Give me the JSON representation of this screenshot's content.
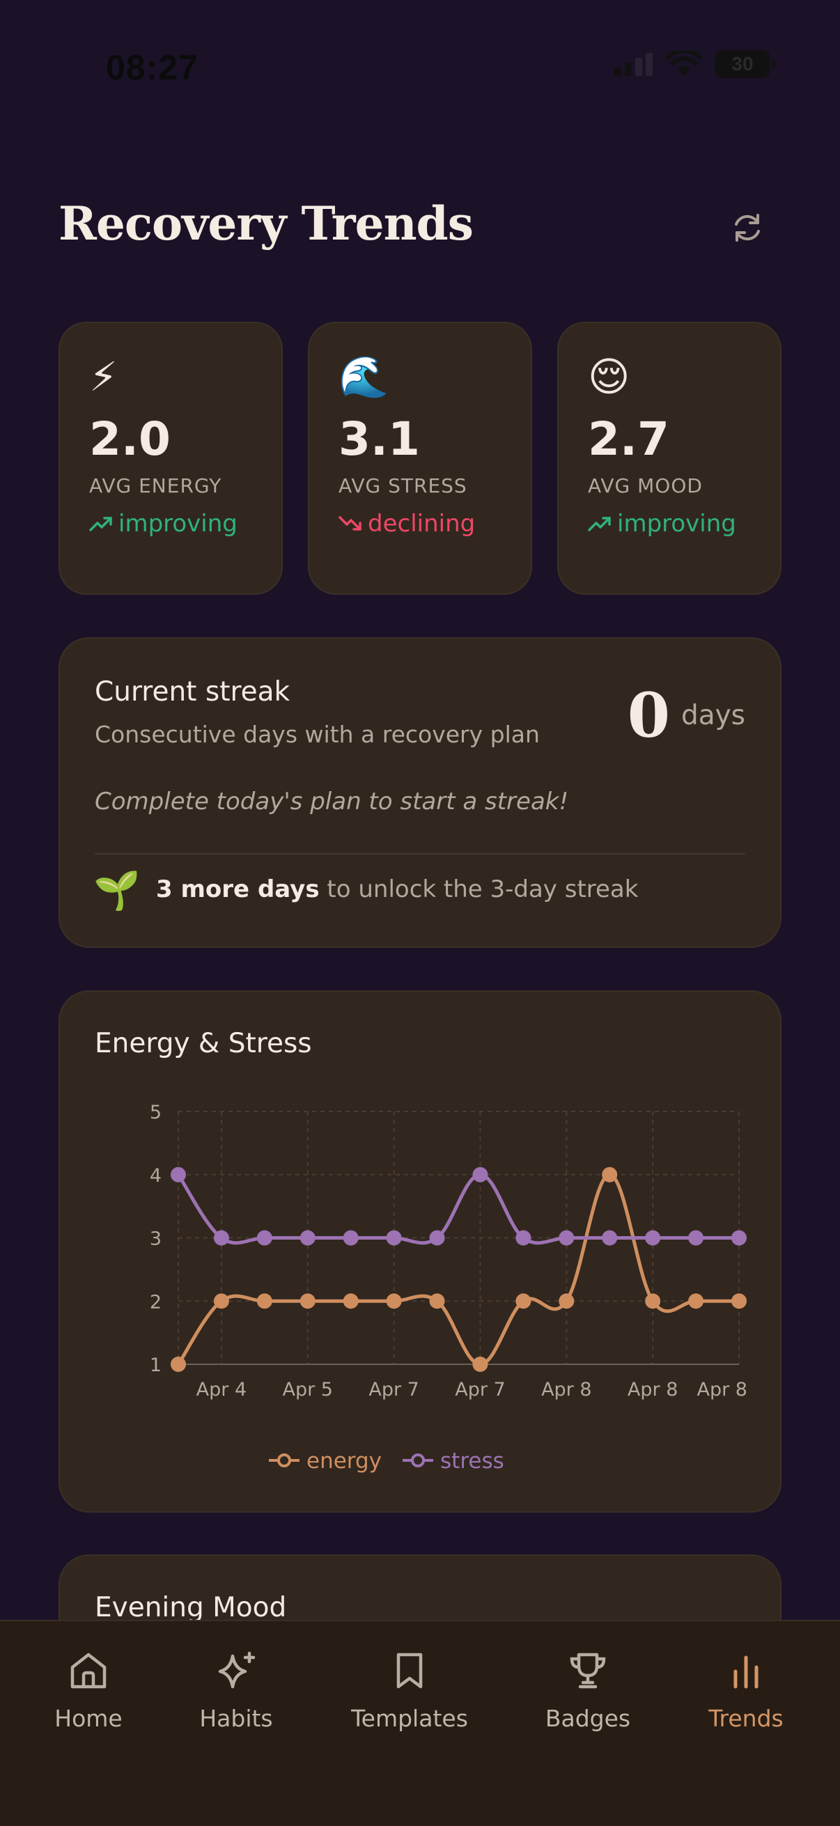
{
  "status_bar": {
    "time": "08:27",
    "battery": "30"
  },
  "header": {
    "title": "Recovery Trends"
  },
  "stats": [
    {
      "emoji": "⚡",
      "value": "2.0",
      "label": "AVG ENERGY",
      "trend": "improving",
      "direction": "up"
    },
    {
      "emoji": "🌊",
      "value": "3.1",
      "label": "AVG STRESS",
      "trend": "declining",
      "direction": "down"
    },
    {
      "emoji": "😌",
      "value": "2.7",
      "label": "AVG MOOD",
      "trend": "improving",
      "direction": "up"
    }
  ],
  "streak": {
    "title": "Current streak",
    "subtitle": "Consecutive days with a recovery plan",
    "count": "0",
    "unit": "days",
    "hint": "Complete today's plan to start a streak!",
    "emoji": "🌱",
    "goal_bold": "3 more days",
    "goal_rest": " to unlock the 3-day streak"
  },
  "chart_card": {
    "title": "Energy & Stress"
  },
  "chart_data": {
    "type": "line",
    "title": "Energy & Stress",
    "x": [
      "Apr 4",
      "Apr 4",
      "Apr 4",
      "Apr 5",
      "Apr 5",
      "Apr 7",
      "Apr 7",
      "Apr 7",
      "Apr 8",
      "Apr 8",
      "Apr 8",
      "Apr 8",
      "Apr 8",
      "Apr 8"
    ],
    "x_tick_labels": [
      "Apr 4",
      "Apr 5",
      "Apr 7",
      "Apr 7",
      "Apr 8",
      "Apr 8",
      "Apr 8"
    ],
    "ylim": [
      1,
      5
    ],
    "yticks": [
      1,
      2,
      3,
      4,
      5
    ],
    "grid": true,
    "legend": "bottom-center",
    "series": [
      {
        "name": "energy",
        "color": "#d08e5f",
        "values": [
          1,
          2,
          2,
          2,
          2,
          2,
          2,
          1,
          2,
          2,
          4,
          2,
          2,
          2
        ]
      },
      {
        "name": "stress",
        "color": "#9d73b3",
        "values": [
          4,
          3,
          3,
          3,
          3,
          3,
          3,
          4,
          3,
          3,
          3,
          3,
          3,
          3
        ]
      }
    ]
  },
  "mood_card": {
    "title": "Evening Mood"
  },
  "nav": [
    {
      "label": "Home",
      "icon": "home-icon",
      "active": false
    },
    {
      "label": "Habits",
      "icon": "sparkle-icon",
      "active": false
    },
    {
      "label": "Templates",
      "icon": "bookmark-icon",
      "active": false
    },
    {
      "label": "Badges",
      "icon": "trophy-icon",
      "active": false
    },
    {
      "label": "Trends",
      "icon": "bar-chart-icon",
      "active": true
    }
  ],
  "colors": {
    "background": "#1b1228",
    "card": "#31271f",
    "accent": "#d59666",
    "improving": "#2fb27b",
    "declining": "#ee4766"
  }
}
